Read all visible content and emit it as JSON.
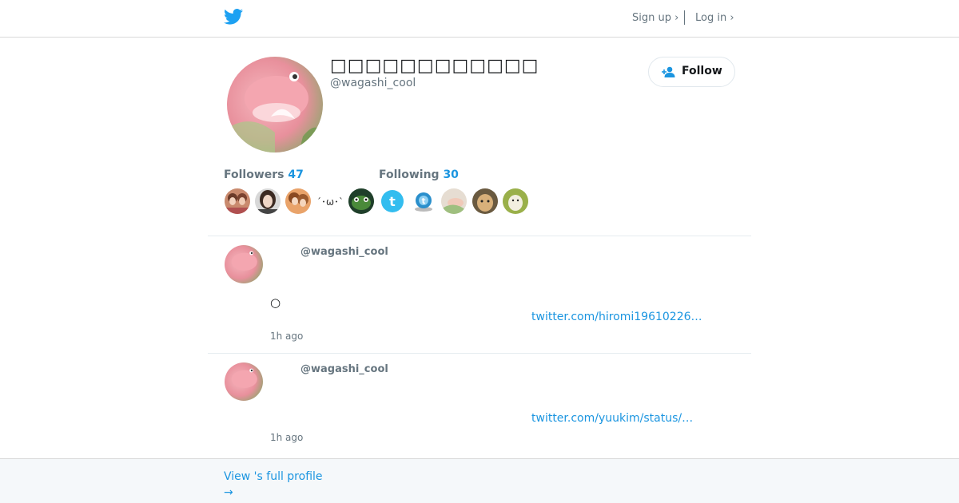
{
  "header": {
    "logo_icon": "twitter-bird-icon",
    "signup_label": "Sign up ›",
    "login_label": "Log in ›"
  },
  "profile": {
    "display_name": "□□□□□□□□□□□□",
    "screen_name": "@wagashi_cool",
    "follow_label": "Follow",
    "followers_label": "Followers",
    "followers_count": "47",
    "following_label": "Following",
    "following_count": "30",
    "follower_emoticon": "´･ω･`"
  },
  "tweets": [
    {
      "handle": "@wagashi_cool",
      "text": "○",
      "link": "twitter.com/hiromi19610226…",
      "time": "1h ago"
    },
    {
      "handle": "@wagashi_cool",
      "text": "",
      "link": "twitter.com/yuukim/status/…",
      "time": "1h ago"
    }
  ],
  "footer": {
    "profile_link_line1": "View 's full profile",
    "profile_link_line2": "→"
  },
  "colors": {
    "accent": "#1b95e0",
    "muted": "#66757f",
    "divider": "#e6ecf0",
    "footer_bg": "#f5f8fa"
  }
}
